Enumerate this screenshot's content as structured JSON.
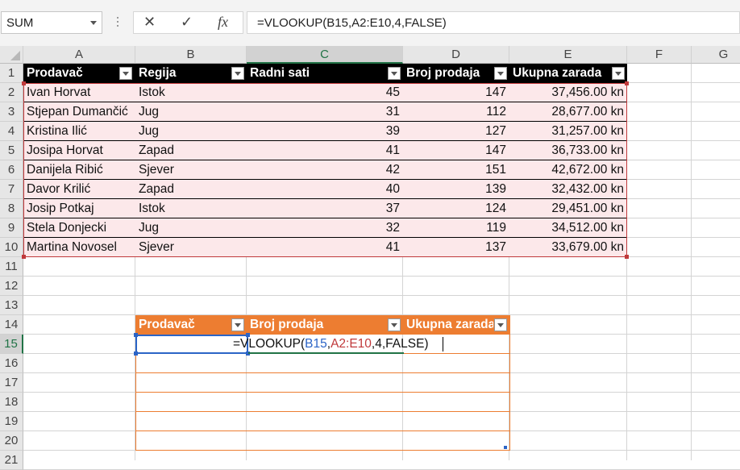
{
  "name_box": {
    "value": "SUM"
  },
  "formula_bar": {
    "cancel_icon": "close-icon",
    "enter_icon": "check-icon",
    "fx_label": "fx",
    "value": "=VLOOKUP(B15,A2:E10,4,FALSE)"
  },
  "columns": [
    "A",
    "B",
    "C",
    "D",
    "E",
    "F",
    "G"
  ],
  "rows": [
    "1",
    "2",
    "3",
    "4",
    "5",
    "6",
    "7",
    "8",
    "9",
    "10",
    "11",
    "12",
    "13",
    "14",
    "15",
    "16",
    "17",
    "18",
    "19",
    "20",
    "21"
  ],
  "selected_column": "C",
  "selected_row": "15",
  "table1": {
    "headers": [
      "Prodavač",
      "Regija",
      "Radni sati",
      "Broj prodaja",
      "Ukupna zarada"
    ],
    "rows": [
      [
        "Ivan Horvat",
        "Istok",
        "45",
        "147",
        "37,456.00 kn"
      ],
      [
        "Stjepan Dumančić",
        "Jug",
        "31",
        "112",
        "28,677.00 kn"
      ],
      [
        "Kristina Ilić",
        "Jug",
        "39",
        "127",
        "31,257.00 kn"
      ],
      [
        "Josipa Horvat",
        "Zapad",
        "41",
        "147",
        "36,733.00 kn"
      ],
      [
        "Danijela Ribić",
        "Sjever",
        "42",
        "151",
        "42,672.00 kn"
      ],
      [
        "Davor Krilić",
        "Zapad",
        "40",
        "139",
        "32,432.00 kn"
      ],
      [
        "Josip Potkaj",
        "Istok",
        "37",
        "124",
        "29,451.00 kn"
      ],
      [
        "Stela Donjecki",
        "Jug",
        "32",
        "119",
        "34,512.00 kn"
      ],
      [
        "Martina Novosel",
        "Sjever",
        "41",
        "137",
        "33,679.00 kn"
      ]
    ],
    "header_color": "#000000",
    "band_color": "#fce8ea",
    "range_color": "#c0393b"
  },
  "table2": {
    "headers": [
      "Prodavač",
      "Broj prodaja",
      "Ukupna zarada"
    ],
    "header_color": "#ed7d31",
    "edit": {
      "prefix": "=VLOOKUP(",
      "ref1": "B15",
      "sep1": ",",
      "ref2": "A2:E10",
      "rest": ",4,FALSE)"
    }
  }
}
